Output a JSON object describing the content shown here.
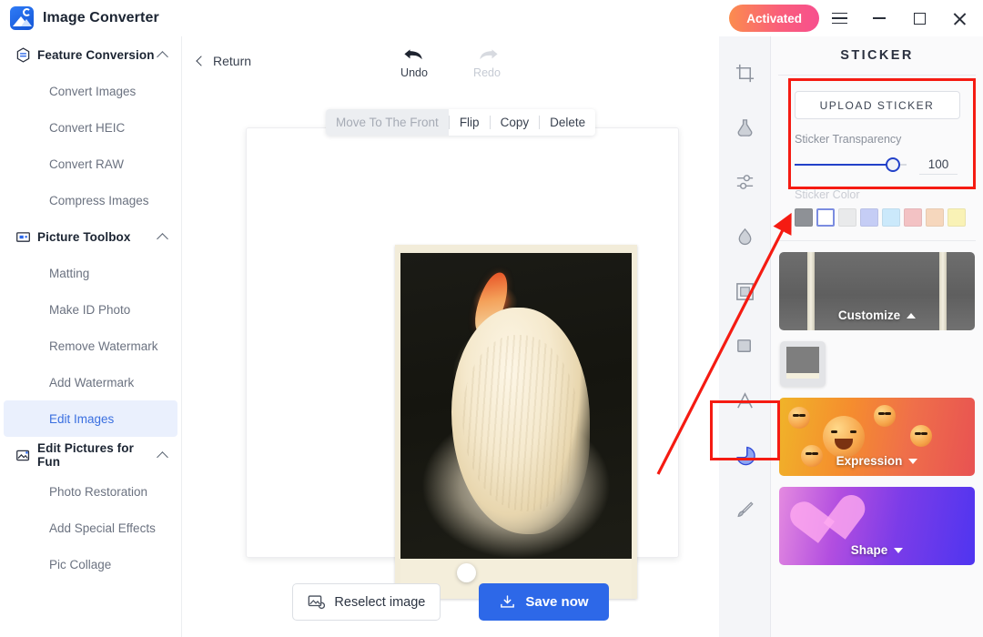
{
  "titlebar": {
    "app_title": "Image Converter",
    "logo_icon": "image-converter-logo",
    "activated_label": "Activated",
    "activated_gradient_from": "#fb8c4e",
    "activated_gradient_to": "#f74f8e",
    "menu_icon": "hamburger-menu-icon",
    "minimize_icon": "minimize-icon",
    "maximize_icon": "maximize-icon",
    "close_icon": "close-icon"
  },
  "sidebar": {
    "groups": [
      {
        "label": "Feature Conversion",
        "icon": "feature-conversion-icon",
        "expanded": true,
        "items": [
          {
            "label": "Convert Images",
            "active": false
          },
          {
            "label": "Convert HEIC",
            "active": false
          },
          {
            "label": "Convert RAW",
            "active": false
          },
          {
            "label": "Compress Images",
            "active": false
          }
        ]
      },
      {
        "label": "Picture Toolbox",
        "icon": "picture-toolbox-icon",
        "expanded": true,
        "items": [
          {
            "label": "Matting",
            "active": false
          },
          {
            "label": "Make ID Photo",
            "active": false
          },
          {
            "label": "Remove Watermark",
            "active": false
          },
          {
            "label": "Add Watermark",
            "active": false
          },
          {
            "label": "Edit Images",
            "active": true
          }
        ]
      },
      {
        "label": "Edit Pictures for Fun",
        "icon": "edit-pictures-for-fun-icon",
        "expanded": true,
        "items": [
          {
            "label": "Photo Restoration",
            "active": false
          },
          {
            "label": "Add Special Effects",
            "active": false
          },
          {
            "label": "Pic Collage",
            "active": false
          }
        ]
      }
    ],
    "active_item": "Edit Images",
    "active_color": "#3a6fe0"
  },
  "editor": {
    "return_label": "Return",
    "undo_label": "Undo",
    "redo_label": "Redo",
    "redo_disabled": true,
    "context_toolbar": [
      {
        "label": "Move To The Front",
        "disabled": true
      },
      {
        "label": "Flip",
        "disabled": false
      },
      {
        "label": "Copy",
        "disabled": false
      },
      {
        "label": "Delete",
        "disabled": false
      }
    ],
    "canvas_image": "pelican-photo-polaroid-sticker",
    "reselect_label": "Reselect image",
    "reselect_icon": "reselect-image-icon",
    "save_label": "Save now",
    "save_icon": "download-icon",
    "save_color": "#2d68e8"
  },
  "toolstrip": {
    "tools": [
      {
        "name": "crop-tool",
        "selected": false
      },
      {
        "name": "filter-flask-tool",
        "selected": false
      },
      {
        "name": "adjust-tool",
        "selected": false
      },
      {
        "name": "blur-droplet-tool",
        "selected": false
      },
      {
        "name": "frame-tool",
        "selected": false
      },
      {
        "name": "shape-rectangle-tool",
        "selected": false
      },
      {
        "name": "text-tool",
        "selected": false
      },
      {
        "name": "sticker-tool",
        "selected": true
      },
      {
        "name": "brush-tool",
        "selected": false
      }
    ],
    "selected_tool": "sticker-tool"
  },
  "sticker_panel": {
    "title": "STICKER",
    "upload_label": "UPLOAD STICKER",
    "transparency_label": "Sticker Transparency",
    "transparency_value": "100",
    "transparency_percent": 88,
    "sticker_color_label": "Sticker Color",
    "colors": [
      {
        "hex": "#8e9196",
        "selected": false
      },
      {
        "hex": "#ffffff",
        "selected": true
      },
      {
        "hex": "#e9eaeb",
        "selected": false
      },
      {
        "hex": "#c5cdf5",
        "selected": false
      },
      {
        "hex": "#cbe9fb",
        "selected": false
      },
      {
        "hex": "#f3c2c4",
        "selected": false
      },
      {
        "hex": "#f6d7bd",
        "selected": false
      },
      {
        "hex": "#f9f2b6",
        "selected": false
      }
    ],
    "categories": [
      {
        "label": "Customize",
        "expanded": true,
        "caret": "up"
      },
      {
        "label": "Expression",
        "expanded": false,
        "caret": "down"
      },
      {
        "label": "Shape",
        "expanded": false,
        "caret": "down"
      }
    ],
    "customize_thumbs": [
      {
        "name": "polaroid-frame-thumbnail",
        "selected": false
      }
    ]
  },
  "annotations": {
    "color": "#f51b12",
    "boxes": [
      {
        "name": "upload-and-transparency-highlight"
      },
      {
        "name": "sticker-tool-highlight"
      }
    ],
    "arrow": {
      "name": "pointer-arrow-to-sticker-colors"
    }
  }
}
